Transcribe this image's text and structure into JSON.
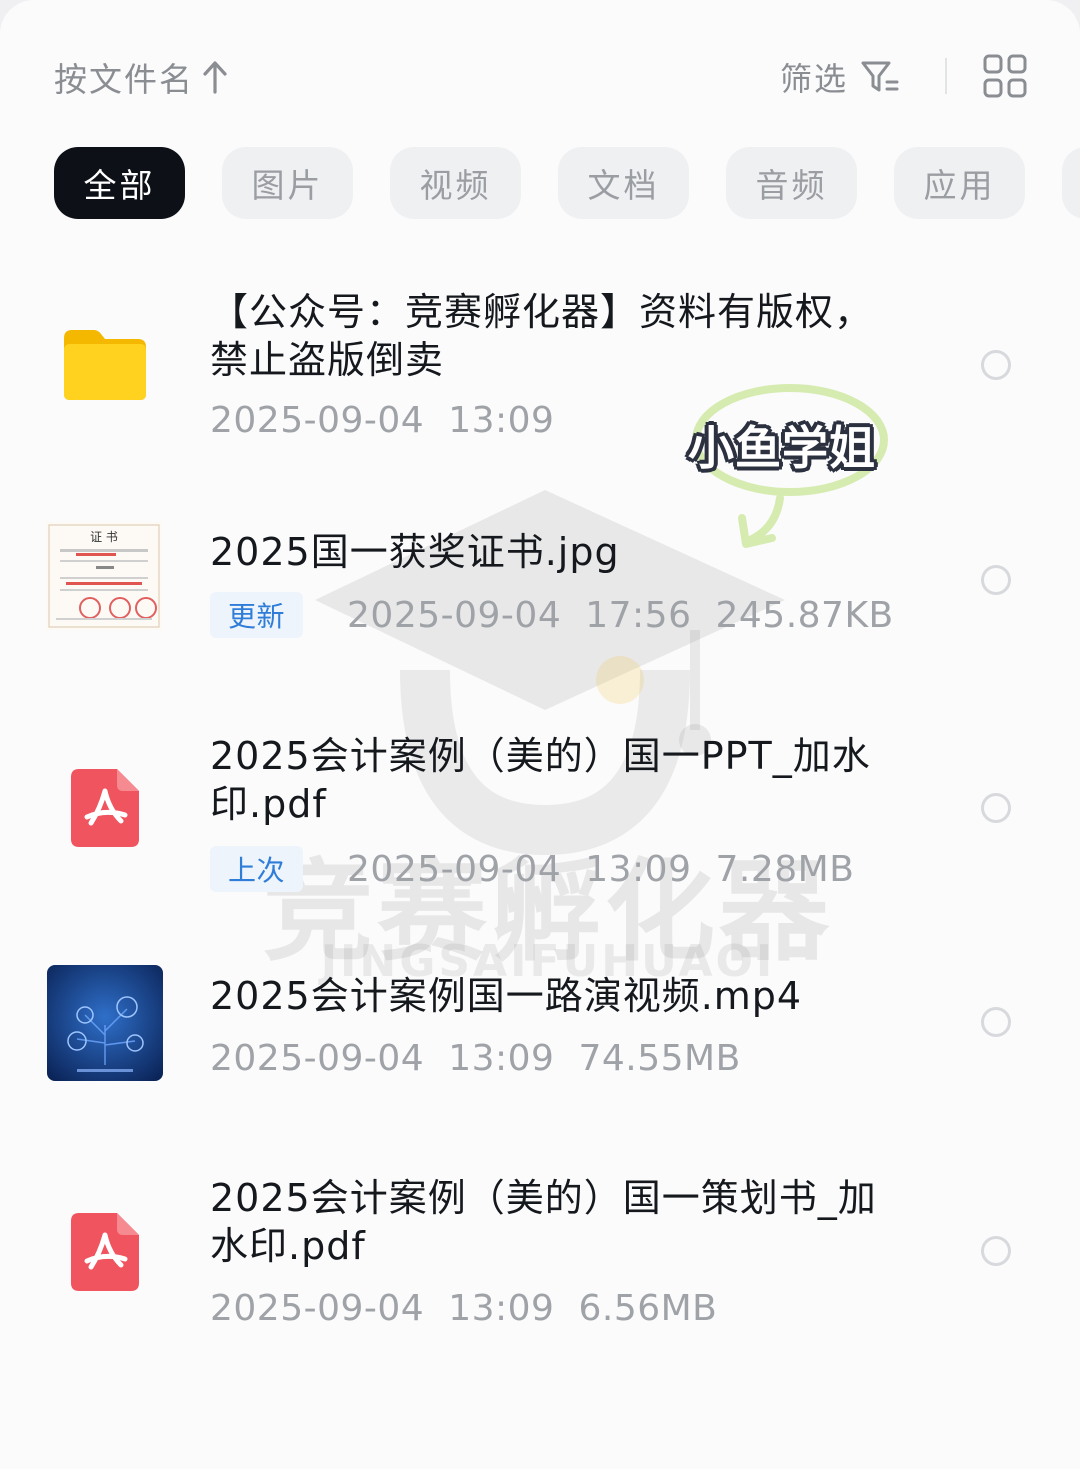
{
  "toolbar": {
    "sort_label": "按文件名",
    "filter_label": "筛选"
  },
  "categories": [
    {
      "label": "全部",
      "active": true
    },
    {
      "label": "图片",
      "active": false
    },
    {
      "label": "视频",
      "active": false
    },
    {
      "label": "文档",
      "active": false
    },
    {
      "label": "音频",
      "active": false
    },
    {
      "label": "应用",
      "active": false
    }
  ],
  "watermark": {
    "text": "竞赛孵化器",
    "subtext": "JINGSAIFUHUAOI"
  },
  "sticker": {
    "text": "小鱼学姐"
  },
  "files": [
    {
      "name_line1": "【公众号：竞赛孵化器】资料有版权，",
      "name_line2": "禁止盗版倒卖",
      "icon": "folder-icon",
      "tag": "",
      "date": "2025-09-04",
      "time": "13:09",
      "size": ""
    },
    {
      "name_line1": "2025国一获奖证书.jpg",
      "name_line2": "",
      "icon": "certificate-thumbnail",
      "tag": "更新",
      "date": "2025-09-04",
      "time": "17:56",
      "size": "245.87KB"
    },
    {
      "name_line1": "2025会计案例（美的）国一PPT_加水",
      "name_line2": "印.pdf",
      "icon": "pdf-icon",
      "tag": "上次",
      "date": "2025-09-04",
      "time": "13:09",
      "size": "7.28MB"
    },
    {
      "name_line1": "2025会计案例国一路演视频.mp4",
      "name_line2": "",
      "icon": "video-thumbnail",
      "tag": "",
      "date": "2025-09-04",
      "time": "13:09",
      "size": "74.55MB"
    },
    {
      "name_line1": "2025会计案例（美的）国一策划书_加",
      "name_line2": "水印.pdf",
      "icon": "pdf-icon",
      "tag": "",
      "date": "2025-09-04",
      "time": "13:09",
      "size": "6.56MB"
    }
  ],
  "colors": {
    "active_chip": "#0d1117",
    "tag_blue": "#2f7dd9",
    "pdf_red": "#f0545e",
    "folder_yellow": "#ffc400"
  }
}
